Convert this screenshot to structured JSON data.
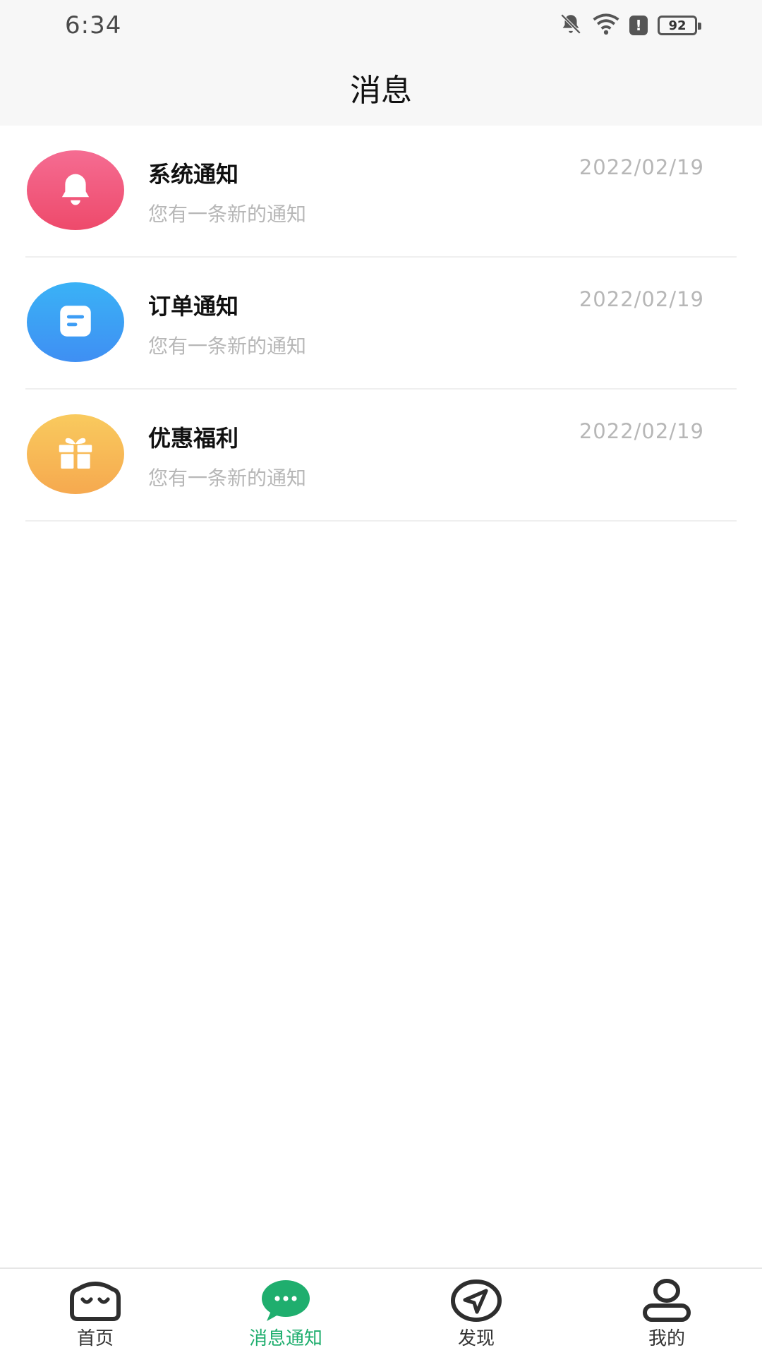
{
  "status_bar": {
    "time": "6:34",
    "battery": "92",
    "icons": [
      "bell-off-icon",
      "wifi-icon",
      "alert-icon",
      "battery-icon"
    ]
  },
  "header": {
    "title": "消息"
  },
  "messages": [
    {
      "title": "系统通知",
      "description": "您有一条新的通知",
      "date": "2022/02/19",
      "icon": "bell-icon",
      "color": "#ef5476"
    },
    {
      "title": "订单通知",
      "description": "您有一条新的通知",
      "date": "2022/02/19",
      "icon": "document-icon",
      "color": "#3d9df5"
    },
    {
      "title": "优惠福利",
      "description": "您有一条新的通知",
      "date": "2022/02/19",
      "icon": "gift-icon",
      "color": "#f7b855"
    }
  ],
  "bottom_nav": [
    {
      "label": "首页",
      "icon": "home-face-icon",
      "active": false
    },
    {
      "label": "消息通知",
      "icon": "chat-bubble-icon",
      "active": true
    },
    {
      "label": "发现",
      "icon": "navigation-arrow-icon",
      "active": false
    },
    {
      "label": "我的",
      "icon": "user-icon",
      "active": false
    }
  ],
  "colors": {
    "accent": "#1fae6e",
    "secondary_text": "#b7b7b7",
    "header_bg": "#f7f7f7"
  }
}
